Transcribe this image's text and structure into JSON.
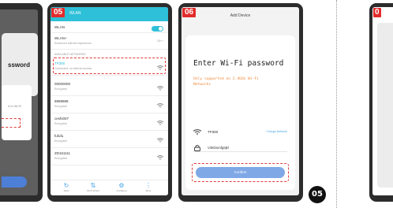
{
  "left_panel": {
    "title_fragment": "ssword",
    "hint_fragment": "d to Wi-Fi"
  },
  "mid_panel": {
    "step": "05",
    "header_title": "WLAN",
    "wlan_label": "WLAN",
    "wlan_plus_label": "WLAN+",
    "wlan_plus_sub": "Enhanced Internet experience",
    "wlan_plus_state": "On",
    "available_label": "AVAILABLE NETWORKS",
    "networks": [
      {
        "name": "TP380",
        "sub": "Connected, no internet access"
      },
      {
        "name": "00000000",
        "sub": "Encrypted"
      },
      {
        "name": "8888888",
        "sub": "Encrypted"
      },
      {
        "name": "ceshi007",
        "sub": "Encrypted"
      },
      {
        "name": "fufufu",
        "sub": "Encrypted"
      },
      {
        "name": "ZD161111",
        "sub": "Encrypted"
      }
    ],
    "nav": [
      {
        "icon": "refresh-icon",
        "label": "Scan"
      },
      {
        "icon": "wifi-direct-icon",
        "label": "Wi-Fi Direct"
      },
      {
        "icon": "settings-icon",
        "label": "Configure"
      },
      {
        "icon": "more-icon",
        "label": "More"
      }
    ]
  },
  "right_panel": {
    "step": "06",
    "screen_title": "Add Device",
    "heading": "Enter Wi-Fi password",
    "support_note": "Only supported on 2.4GHz Wi-Fi Networks",
    "ssid": "TP380",
    "change_network": "Change Network",
    "password": "V38Osmfg9jkl",
    "confirm": "Confirm"
  },
  "step_circle": "05",
  "edge_panel": {
    "step_fragment": "0"
  },
  "colors": {
    "accent": "#2ec0d8",
    "highlight": "#e23a3a",
    "button": "#7fa8e6",
    "warning_text": "#f08a3a"
  }
}
